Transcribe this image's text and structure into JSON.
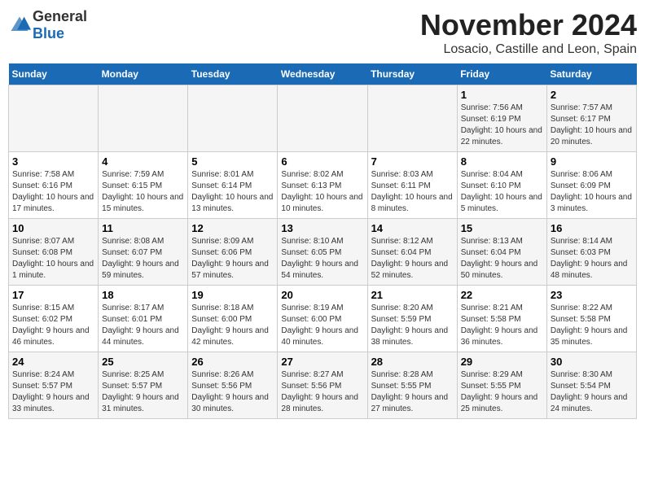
{
  "header": {
    "logo_general": "General",
    "logo_blue": "Blue",
    "month_title": "November 2024",
    "location": "Losacio, Castille and Leon, Spain"
  },
  "days_of_week": [
    "Sunday",
    "Monday",
    "Tuesday",
    "Wednesday",
    "Thursday",
    "Friday",
    "Saturday"
  ],
  "weeks": [
    [
      {
        "day": "",
        "info": ""
      },
      {
        "day": "",
        "info": ""
      },
      {
        "day": "",
        "info": ""
      },
      {
        "day": "",
        "info": ""
      },
      {
        "day": "",
        "info": ""
      },
      {
        "day": "1",
        "info": "Sunrise: 7:56 AM\nSunset: 6:19 PM\nDaylight: 10 hours and 22 minutes."
      },
      {
        "day": "2",
        "info": "Sunrise: 7:57 AM\nSunset: 6:17 PM\nDaylight: 10 hours and 20 minutes."
      }
    ],
    [
      {
        "day": "3",
        "info": "Sunrise: 7:58 AM\nSunset: 6:16 PM\nDaylight: 10 hours and 17 minutes."
      },
      {
        "day": "4",
        "info": "Sunrise: 7:59 AM\nSunset: 6:15 PM\nDaylight: 10 hours and 15 minutes."
      },
      {
        "day": "5",
        "info": "Sunrise: 8:01 AM\nSunset: 6:14 PM\nDaylight: 10 hours and 13 minutes."
      },
      {
        "day": "6",
        "info": "Sunrise: 8:02 AM\nSunset: 6:13 PM\nDaylight: 10 hours and 10 minutes."
      },
      {
        "day": "7",
        "info": "Sunrise: 8:03 AM\nSunset: 6:11 PM\nDaylight: 10 hours and 8 minutes."
      },
      {
        "day": "8",
        "info": "Sunrise: 8:04 AM\nSunset: 6:10 PM\nDaylight: 10 hours and 5 minutes."
      },
      {
        "day": "9",
        "info": "Sunrise: 8:06 AM\nSunset: 6:09 PM\nDaylight: 10 hours and 3 minutes."
      }
    ],
    [
      {
        "day": "10",
        "info": "Sunrise: 8:07 AM\nSunset: 6:08 PM\nDaylight: 10 hours and 1 minute."
      },
      {
        "day": "11",
        "info": "Sunrise: 8:08 AM\nSunset: 6:07 PM\nDaylight: 9 hours and 59 minutes."
      },
      {
        "day": "12",
        "info": "Sunrise: 8:09 AM\nSunset: 6:06 PM\nDaylight: 9 hours and 57 minutes."
      },
      {
        "day": "13",
        "info": "Sunrise: 8:10 AM\nSunset: 6:05 PM\nDaylight: 9 hours and 54 minutes."
      },
      {
        "day": "14",
        "info": "Sunrise: 8:12 AM\nSunset: 6:04 PM\nDaylight: 9 hours and 52 minutes."
      },
      {
        "day": "15",
        "info": "Sunrise: 8:13 AM\nSunset: 6:04 PM\nDaylight: 9 hours and 50 minutes."
      },
      {
        "day": "16",
        "info": "Sunrise: 8:14 AM\nSunset: 6:03 PM\nDaylight: 9 hours and 48 minutes."
      }
    ],
    [
      {
        "day": "17",
        "info": "Sunrise: 8:15 AM\nSunset: 6:02 PM\nDaylight: 9 hours and 46 minutes."
      },
      {
        "day": "18",
        "info": "Sunrise: 8:17 AM\nSunset: 6:01 PM\nDaylight: 9 hours and 44 minutes."
      },
      {
        "day": "19",
        "info": "Sunrise: 8:18 AM\nSunset: 6:00 PM\nDaylight: 9 hours and 42 minutes."
      },
      {
        "day": "20",
        "info": "Sunrise: 8:19 AM\nSunset: 6:00 PM\nDaylight: 9 hours and 40 minutes."
      },
      {
        "day": "21",
        "info": "Sunrise: 8:20 AM\nSunset: 5:59 PM\nDaylight: 9 hours and 38 minutes."
      },
      {
        "day": "22",
        "info": "Sunrise: 8:21 AM\nSunset: 5:58 PM\nDaylight: 9 hours and 36 minutes."
      },
      {
        "day": "23",
        "info": "Sunrise: 8:22 AM\nSunset: 5:58 PM\nDaylight: 9 hours and 35 minutes."
      }
    ],
    [
      {
        "day": "24",
        "info": "Sunrise: 8:24 AM\nSunset: 5:57 PM\nDaylight: 9 hours and 33 minutes."
      },
      {
        "day": "25",
        "info": "Sunrise: 8:25 AM\nSunset: 5:57 PM\nDaylight: 9 hours and 31 minutes."
      },
      {
        "day": "26",
        "info": "Sunrise: 8:26 AM\nSunset: 5:56 PM\nDaylight: 9 hours and 30 minutes."
      },
      {
        "day": "27",
        "info": "Sunrise: 8:27 AM\nSunset: 5:56 PM\nDaylight: 9 hours and 28 minutes."
      },
      {
        "day": "28",
        "info": "Sunrise: 8:28 AM\nSunset: 5:55 PM\nDaylight: 9 hours and 27 minutes."
      },
      {
        "day": "29",
        "info": "Sunrise: 8:29 AM\nSunset: 5:55 PM\nDaylight: 9 hours and 25 minutes."
      },
      {
        "day": "30",
        "info": "Sunrise: 8:30 AM\nSunset: 5:54 PM\nDaylight: 9 hours and 24 minutes."
      }
    ]
  ]
}
